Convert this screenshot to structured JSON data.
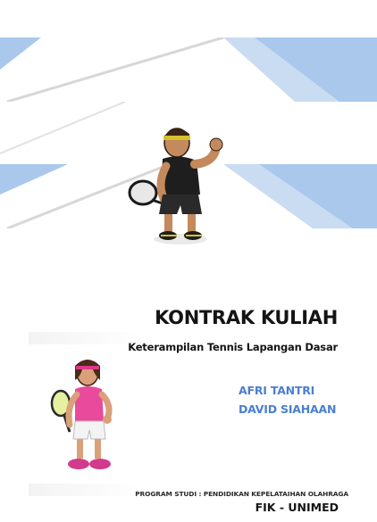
{
  "cover": {
    "title": "KONTRAK KULIAH",
    "subtitle": "Keterampilan Tennis Lapangan Dasar",
    "authors": [
      "AFRI TANTRI",
      "DAVID SIAHAAN"
    ],
    "program": "PROGRAM STUDI : PENDIDIKAN KEPELATAIHAN OLAHRAGA",
    "faculty": "FIK - UNIMED"
  },
  "colors": {
    "court_blue": "#a9c8ec",
    "author_blue": "#4a7fcf",
    "text_dark": "#141414"
  },
  "illustrations": [
    "tennis-player-cartoon-black-outfit",
    "tennis-player-cartoon-pink-outfit"
  ]
}
